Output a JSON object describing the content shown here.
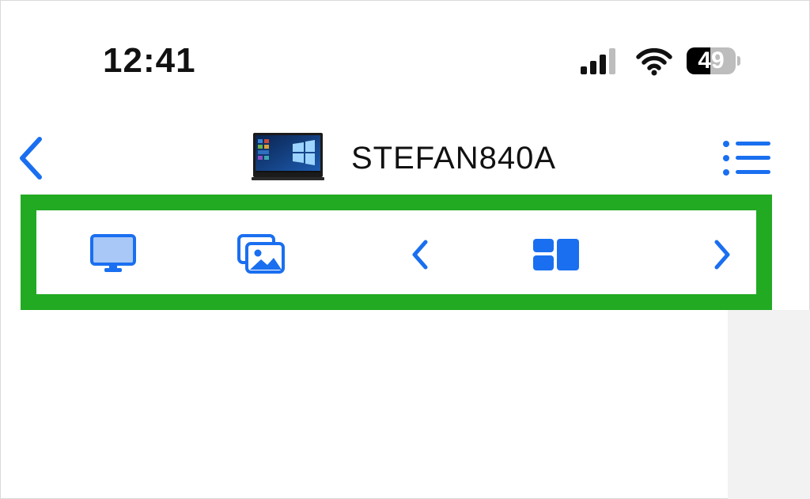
{
  "status_bar": {
    "time": "12:41",
    "battery_level": "49",
    "battery_fraction": 0.49,
    "signal_icon": "cellular-signal-icon",
    "wifi_icon": "wifi-icon",
    "battery_icon": "battery-icon"
  },
  "nav": {
    "back_icon": "chevron-left-icon",
    "device_name": "STEFAN840A",
    "device_thumbnail": "laptop-screen-thumbnail",
    "menu_icon": "list-icon"
  },
  "toolbar": {
    "items": [
      {
        "name": "monitor-icon",
        "action": "screen"
      },
      {
        "name": "photo-library-icon",
        "action": "media"
      },
      {
        "name": "chevron-left-icon",
        "action": "previous"
      },
      {
        "name": "layout-grid-icon",
        "action": "layout"
      },
      {
        "name": "chevron-right-icon",
        "action": "next"
      }
    ]
  },
  "colors": {
    "accent": "#1a6ff0",
    "accent_light": "#a9c8f7",
    "highlight_border": "#22aa22",
    "panel_gray": "#f2f2f2"
  }
}
